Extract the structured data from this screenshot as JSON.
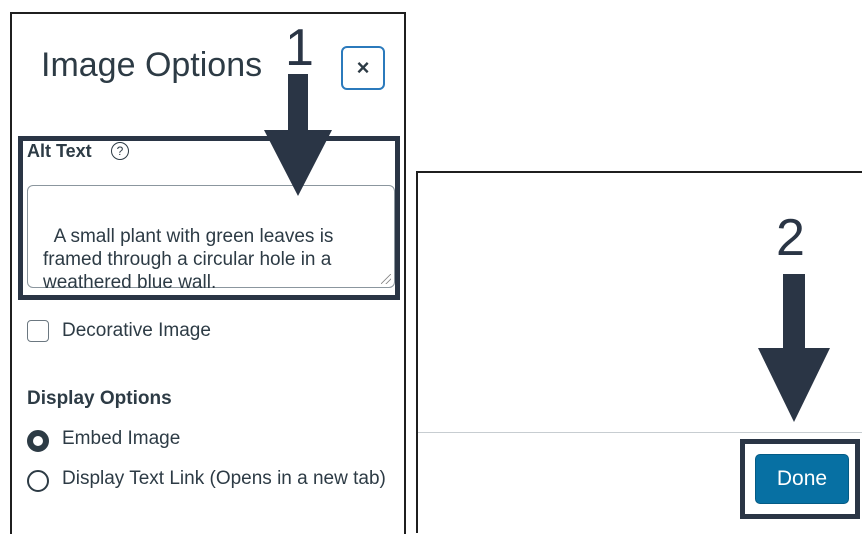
{
  "dialog": {
    "title": "Image Options",
    "close_icon": "×",
    "alt_text_label": "Alt Text",
    "help_icon": "?",
    "alt_text_value": "A small plant with green leaves is\nframed through a circular hole in a\nweathered blue wall.",
    "decorative_label": "Decorative Image",
    "decorative_checked": false,
    "display_options_heading": "Display Options",
    "radio_options": [
      {
        "label": "Embed Image",
        "checked": true
      },
      {
        "label": "Display Text Link (Opens in a new tab)",
        "checked": false
      }
    ]
  },
  "footer": {
    "done_label": "Done"
  },
  "annotations": {
    "step1": "1",
    "step2": "2",
    "color": "#2a3545"
  },
  "colors": {
    "accent_blue": "#0770a3",
    "close_border": "#2b7abc",
    "text": "#2d3b45"
  }
}
